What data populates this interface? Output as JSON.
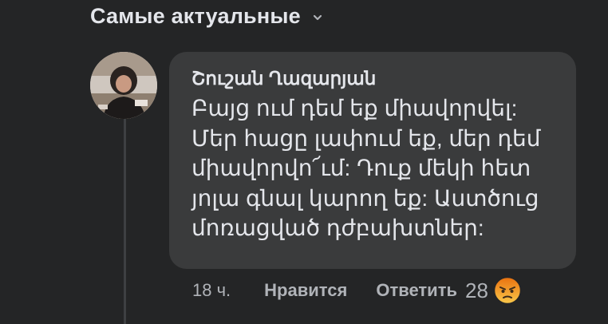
{
  "filter": {
    "label": "Самые актуальные"
  },
  "comment": {
    "author": "Շուշան Ղազարյան",
    "lines": [
      "Բայց ում դեմ եք միավորվել:",
      "Մեր հացը լափում եք, մեր դեմ",
      "միավորվո՜ւմ: Դուք մեկի հետ",
      "յոլա գնալ կարող եք: Աստծուց",
      "մոռացված դժբախտներ:"
    ],
    "time": "18 ч.",
    "like_label": "Нравится",
    "reply_label": "Ответить",
    "reaction_count": "28",
    "reaction_icon": "angry-face-icon"
  },
  "colors": {
    "background": "#242526",
    "bubble": "#3a3b3c",
    "text": "#e4e6eb",
    "muted": "#b0b3b8",
    "angry_top": "#f9c84a",
    "angry_bottom": "#e9710f"
  }
}
